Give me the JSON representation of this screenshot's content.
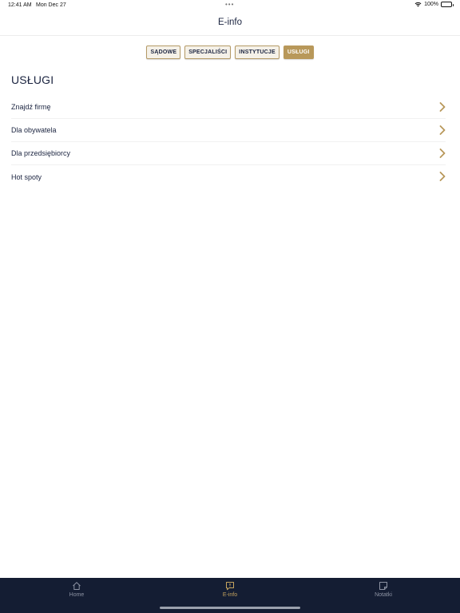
{
  "status_bar": {
    "time": "12:41 AM",
    "date": "Mon Dec 27",
    "battery": "100%"
  },
  "nav": {
    "title": "E-info"
  },
  "tabs": [
    {
      "label": "SĄDOWE",
      "active": false
    },
    {
      "label": "SPECJALIŚCI",
      "active": false
    },
    {
      "label": "INSTYTUCJE",
      "active": false
    },
    {
      "label": "USŁUGI",
      "active": true
    }
  ],
  "section": {
    "title": "USŁUGI",
    "items": [
      {
        "label": "Znajdź firmę",
        "icon": "chevron-right-icon"
      },
      {
        "label": "Dla obywatela",
        "icon": "chevron-right-icon"
      },
      {
        "label": "Dla przedsiębiorcy",
        "icon": "chevron-right-icon"
      },
      {
        "label": "Hot spoty",
        "icon": "chevron-right-icon"
      }
    ]
  },
  "tab_bar": {
    "items": [
      {
        "label": "Home",
        "icon": "house-icon",
        "active": false
      },
      {
        "label": "E-info",
        "icon": "info-bubble-icon",
        "active": true
      },
      {
        "label": "Notatki",
        "icon": "note-icon",
        "active": false
      }
    ]
  },
  "colors": {
    "accent": "#b8985a",
    "navy": "#1b2440",
    "tab_bar_bg": "#141d33",
    "tab_bar_inactive": "#8d93a3",
    "tab_bar_active": "#c5a45f"
  }
}
